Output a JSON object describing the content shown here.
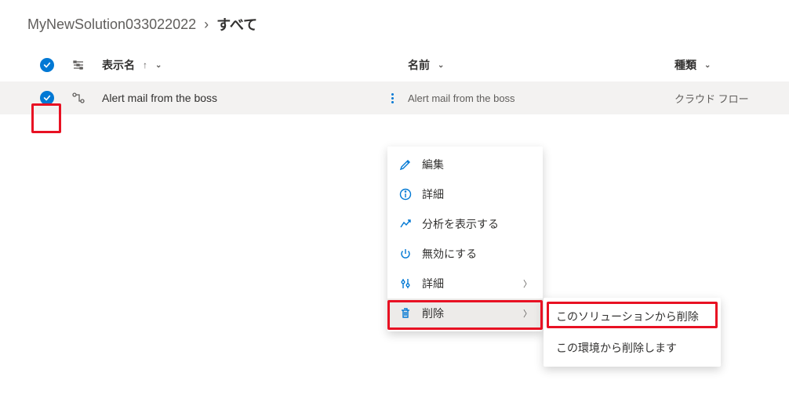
{
  "breadcrumb": {
    "solution": "MyNewSolution033022022",
    "current": "すべて"
  },
  "columns": {
    "display_name": "表示名",
    "name": "名前",
    "type": "種類"
  },
  "row": {
    "display_name": "Alert mail from the boss",
    "name": "Alert mail from the boss",
    "type": "クラウド フロー"
  },
  "menu": {
    "edit": "編集",
    "details": "詳細",
    "show_analytics": "分析を表示する",
    "turn_off": "無効にする",
    "advanced": "詳細",
    "delete": "削除"
  },
  "submenu": {
    "remove_from_solution": "このソリューションから削除",
    "delete_from_environment": "この環境から削除します"
  }
}
